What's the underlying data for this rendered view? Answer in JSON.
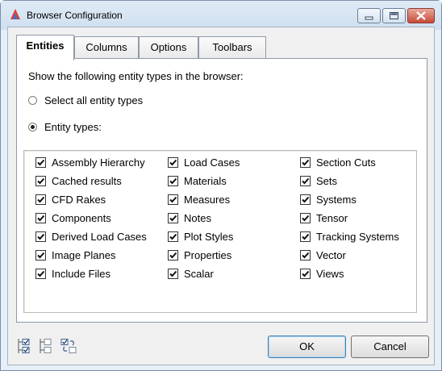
{
  "window": {
    "title": "Browser Configuration"
  },
  "tabs": [
    {
      "label": "Entities",
      "active": true
    },
    {
      "label": "Columns",
      "active": false
    },
    {
      "label": "Options",
      "active": false
    },
    {
      "label": "Toolbars",
      "active": false
    }
  ],
  "entities_panel": {
    "prompt": "Show the following entity types in the browser:",
    "radio_all": {
      "label": "Select all entity types",
      "checked": false
    },
    "radio_types": {
      "label": "Entity types:",
      "checked": true
    },
    "columns": [
      [
        {
          "label": "Assembly Hierarchy",
          "checked": true
        },
        {
          "label": "Cached results",
          "checked": true
        },
        {
          "label": "CFD Rakes",
          "checked": true
        },
        {
          "label": "Components",
          "checked": true
        },
        {
          "label": "Derived Load Cases",
          "checked": true
        },
        {
          "label": "Image Planes",
          "checked": true
        },
        {
          "label": "Include Files",
          "checked": true
        }
      ],
      [
        {
          "label": "Load Cases",
          "checked": true
        },
        {
          "label": "Materials",
          "checked": true
        },
        {
          "label": "Measures",
          "checked": true
        },
        {
          "label": "Notes",
          "checked": true
        },
        {
          "label": "Plot Styles",
          "checked": true
        },
        {
          "label": "Properties",
          "checked": true
        },
        {
          "label": "Scalar",
          "checked": true
        }
      ],
      [
        {
          "label": "Section Cuts",
          "checked": true
        },
        {
          "label": "Sets",
          "checked": true
        },
        {
          "label": "Systems",
          "checked": true
        },
        {
          "label": "Tensor",
          "checked": true
        },
        {
          "label": "Tracking Systems",
          "checked": true
        },
        {
          "label": "Vector",
          "checked": true
        },
        {
          "label": "Views",
          "checked": true
        }
      ]
    ]
  },
  "bottom_icons": [
    "check-all-icon",
    "uncheck-all-icon",
    "invert-selection-icon"
  ],
  "buttons": {
    "ok": "OK",
    "cancel": "Cancel"
  }
}
